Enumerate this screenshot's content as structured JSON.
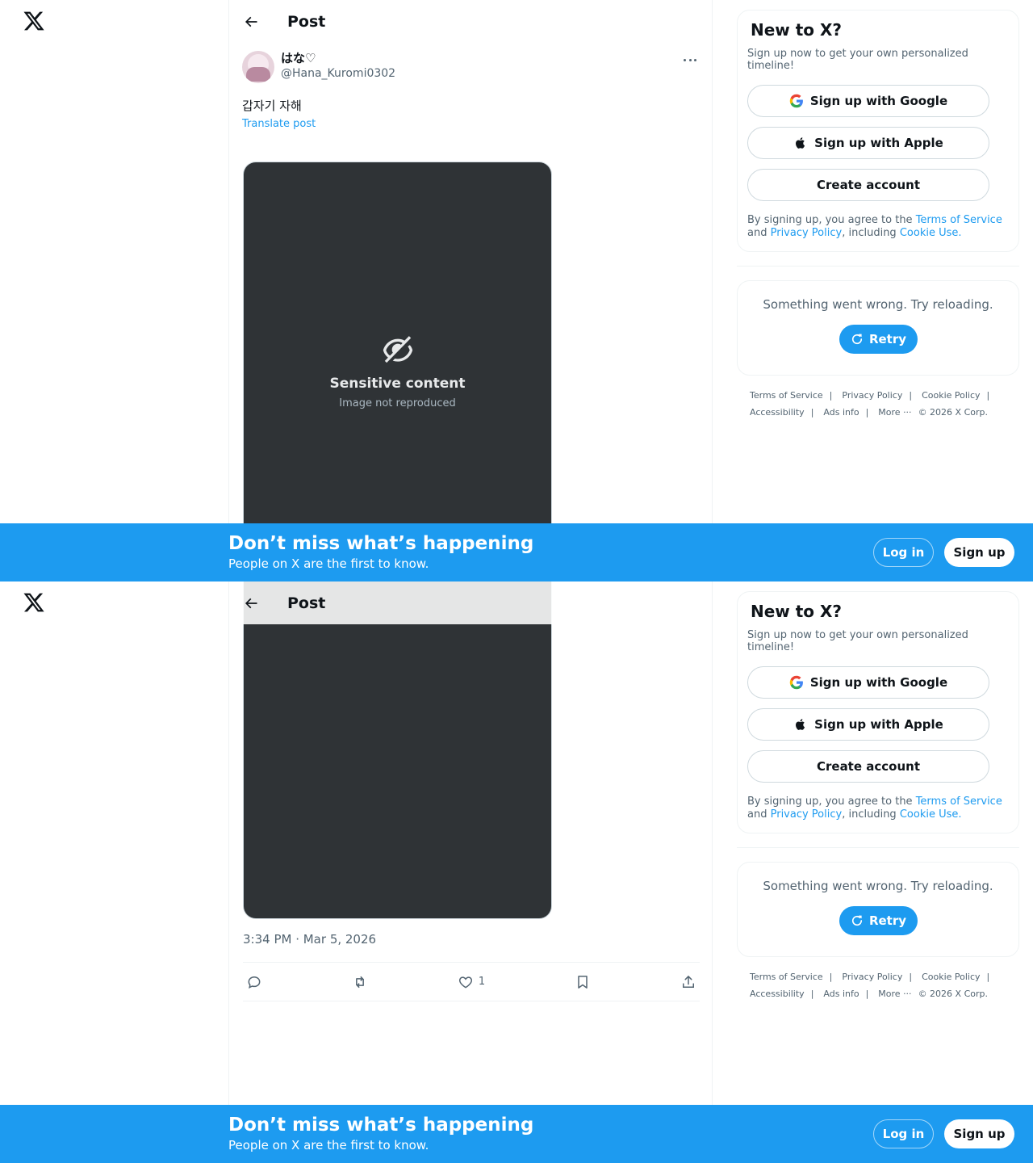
{
  "header": {
    "title": "Post"
  },
  "post": {
    "display_name": "はな♡",
    "handle": "@Hana_Kuromi0302",
    "text_line": "갑자기 자해",
    "hashtag": "",
    "translate": "Translate post",
    "timestamp": "3:34 PM · Mar 5, 2026",
    "likes": "1",
    "media_notice": {
      "title": "Sensitive content",
      "note": "Image not reproduced"
    }
  },
  "sidebar": {
    "new_to_x": "New to X?",
    "subtitle": "Sign up now to get your own personalized timeline!",
    "google": "Sign up with Google",
    "apple": "Sign up with Apple",
    "create": "Create account",
    "legal_1": "By signing up, you agree to the",
    "terms": "Terms of Service",
    "legal_2": "and",
    "privacy": "Privacy Policy",
    "legal_3": ", including",
    "cookie": "Cookie Use.",
    "error": "Something went wrong. Try reloading.",
    "retry": "Retry",
    "footer": {
      "terms": "Terms of Service",
      "privacy": "Privacy Policy",
      "cookie": "Cookie Policy",
      "accessibility": "Accessibility",
      "ads": "Ads info",
      "more": "More ···",
      "copyright": "© 2026 X Corp."
    }
  },
  "banner": {
    "title": "Don’t miss what’s happening",
    "subtitle": "People on X are the first to know.",
    "login": "Log in",
    "signup": "Sign up"
  },
  "colors": {
    "accent": "#1d9bf0",
    "text": "#0f1419",
    "secondary": "#536471",
    "border": "#eff3f4"
  },
  "icons": [
    "x-logo-icon",
    "back-arrow-icon",
    "more-icon",
    "reply-icon",
    "repost-icon",
    "like-icon",
    "bookmark-icon",
    "share-icon",
    "google-icon",
    "apple-icon",
    "retry-icon",
    "hidden-media-icon"
  ]
}
